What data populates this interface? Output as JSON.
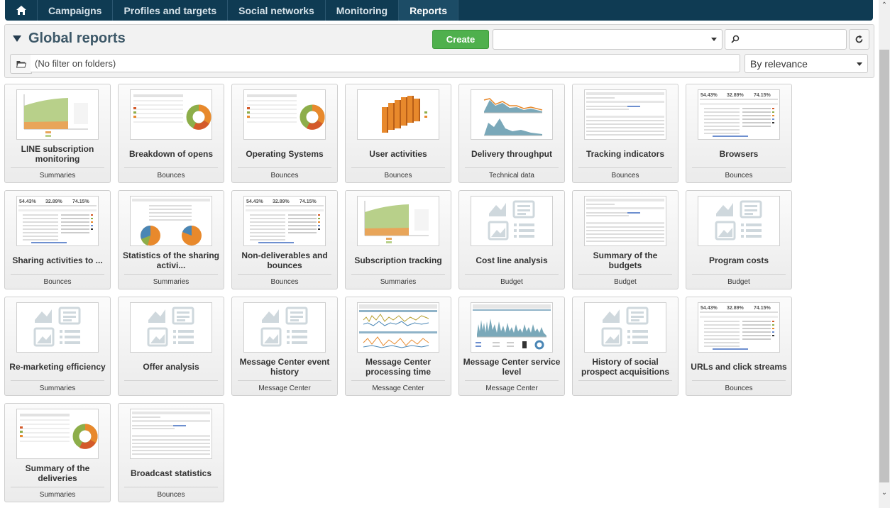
{
  "nav": {
    "tabs": [
      {
        "label": "Campaigns"
      },
      {
        "label": "Profiles and targets"
      },
      {
        "label": "Social networks"
      },
      {
        "label": "Monitoring"
      },
      {
        "label": "Reports",
        "active": true
      }
    ]
  },
  "header": {
    "title": "Global reports",
    "create_label": "Create",
    "filter_text": "(No filter on folders)",
    "sort_value": "By relevance"
  },
  "cards": [
    {
      "name": "LINE subscription monitoring",
      "category": "Summaries",
      "thumb": "area"
    },
    {
      "name": "Breakdown of opens",
      "category": "Bounces",
      "thumb": "donut"
    },
    {
      "name": "Operating Systems",
      "category": "Bounces",
      "thumb": "donut"
    },
    {
      "name": "User activities",
      "category": "Bounces",
      "thumb": "bars3d"
    },
    {
      "name": "Delivery throughput",
      "category": "Technical data",
      "thumb": "throughput"
    },
    {
      "name": "Tracking indicators",
      "category": "Bounces",
      "thumb": "table"
    },
    {
      "name": "Browsers",
      "category": "Bounces",
      "thumb": "stats"
    },
    {
      "name": "Sharing activities to ...",
      "category": "Bounces",
      "thumb": "stats"
    },
    {
      "name": "Statistics of the sharing activi...",
      "category": "Summaries",
      "thumb": "pies"
    },
    {
      "name": "Non-deliverables and bounces",
      "category": "Bounces",
      "thumb": "stats"
    },
    {
      "name": "Subscription tracking",
      "category": "Summaries",
      "thumb": "area"
    },
    {
      "name": "Cost line analysis",
      "category": "Budget",
      "thumb": "placeholder"
    },
    {
      "name": "Summary of the budgets",
      "category": "Budget",
      "thumb": "table"
    },
    {
      "name": "Program costs",
      "category": "Budget",
      "thumb": "placeholder"
    },
    {
      "name": "Re-marketing efficiency",
      "category": "Summaries",
      "thumb": "placeholder"
    },
    {
      "name": "Offer analysis",
      "category": "",
      "thumb": "placeholder"
    },
    {
      "name": "Message Center event history",
      "category": "Message Center",
      "thumb": "placeholder"
    },
    {
      "name": "Message Center processing time",
      "category": "Message Center",
      "thumb": "lines"
    },
    {
      "name": "Message Center service level",
      "category": "Message Center",
      "thumb": "spiky"
    },
    {
      "name": "History of social prospect acquisitions",
      "category": "",
      "thumb": "placeholder"
    },
    {
      "name": "URLs and click streams",
      "category": "Bounces",
      "thumb": "stats"
    },
    {
      "name": "Summary of the deliveries",
      "category": "Summaries",
      "thumb": "donut"
    },
    {
      "name": "Broadcast statistics",
      "category": "Bounces",
      "thumb": "table"
    }
  ],
  "colors": {
    "nav_bg": "#0f3b53",
    "create_green": "#4fb04d",
    "orange": "#e8892c",
    "green": "#8dae4a"
  }
}
